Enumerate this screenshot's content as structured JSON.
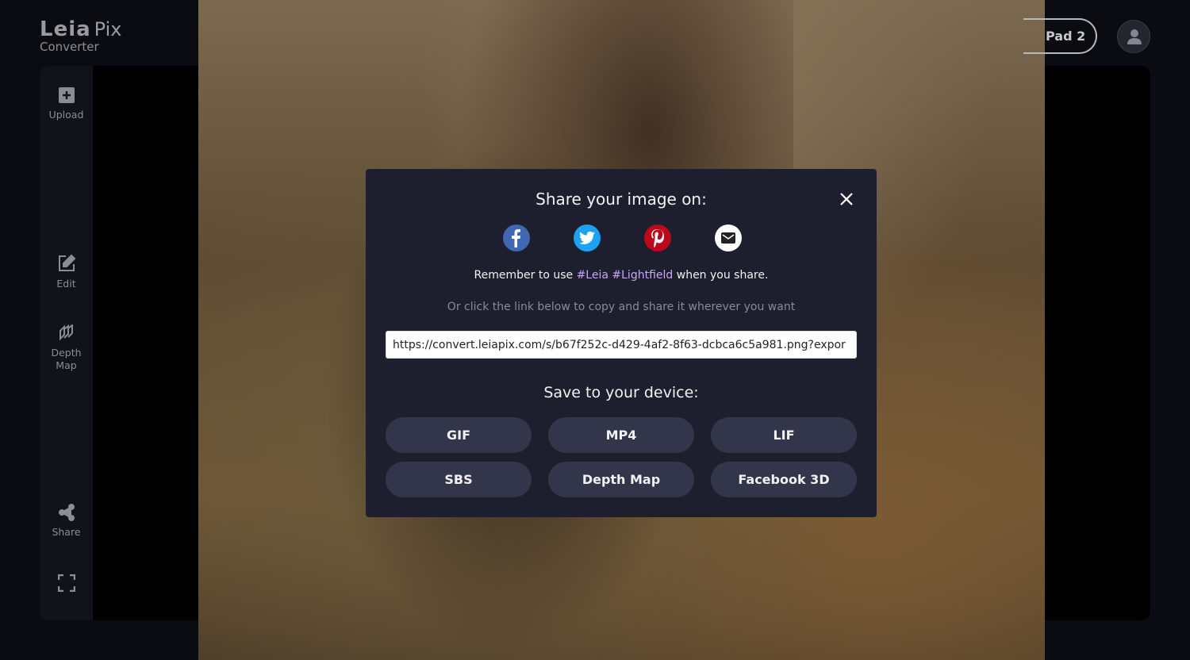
{
  "app": {
    "brand": "Leia",
    "brand_suffix": "Pix",
    "subtitle": "Converter"
  },
  "header": {
    "device_button": "Pad 2",
    "avatar_icon": "user-icon"
  },
  "sidebar": {
    "items": [
      {
        "label": "Upload",
        "icon": "plus-square-icon"
      },
      {
        "label": "Edit",
        "icon": "edit-icon"
      },
      {
        "label": "Depth Map",
        "icon": "layers-icon"
      },
      {
        "label": "Share",
        "icon": "share-icon"
      },
      {
        "label": "",
        "icon": "fullscreen-icon"
      }
    ]
  },
  "modal": {
    "title": "Share your image on:",
    "social": [
      {
        "name": "facebook",
        "color": "#4267b2"
      },
      {
        "name": "twitter",
        "color": "#1da1f2"
      },
      {
        "name": "pinterest",
        "color": "#bd081c"
      },
      {
        "name": "email",
        "color": "#ffffff"
      }
    ],
    "remember_pre": "Remember to use ",
    "tag1": "#Leia",
    "tag2": "#Lightfield",
    "remember_post": " when you share.",
    "or_text": "Or click the link below to copy and share it wherever you want",
    "link": "https://convert.leiapix.com/s/b67f252c-d429-4af2-8f63-dcbca6c5a981.png?expor",
    "save_title": "Save to your device:",
    "buttons": [
      "GIF",
      "MP4",
      "LIF",
      "SBS",
      "Depth Map",
      "Facebook 3D"
    ]
  }
}
